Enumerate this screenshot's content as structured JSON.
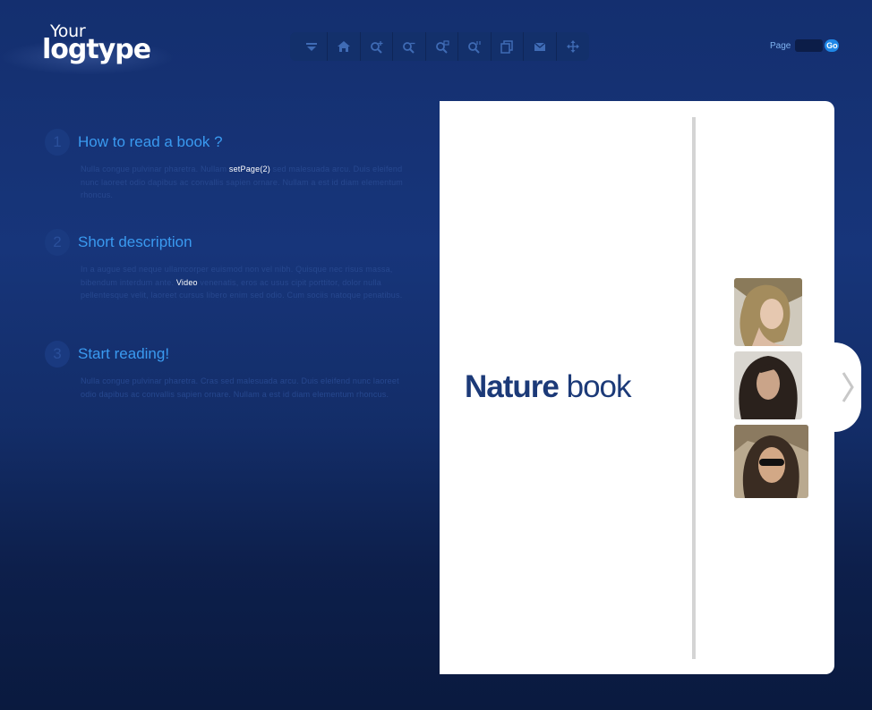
{
  "logo": {
    "line1": "Your",
    "line2": "logtype"
  },
  "toolbar": {
    "buttons": [
      {
        "name": "dropdown-arrow-icon"
      },
      {
        "name": "home-icon"
      },
      {
        "name": "zoom-in-icon"
      },
      {
        "name": "zoom-out-icon"
      },
      {
        "name": "zoom-fit-icon"
      },
      {
        "name": "zoom-actual-icon"
      },
      {
        "name": "pages-icon"
      },
      {
        "name": "email-icon"
      },
      {
        "name": "fullscreen-icon"
      }
    ]
  },
  "page_control": {
    "label": "Page",
    "value": "",
    "go_label": "Go"
  },
  "steps": [
    {
      "number": "1",
      "title": "How to read a book ?",
      "body_pre": "Nulla congue pulvinar pharetra. Nullam ",
      "body_link": "setPage(2)",
      "body_post": " sed malesuada arcu. Duis eleifend nunc laoreet odio dapibus ac convallis sapien ornare. Nullam a est id diam elementum rhoncus."
    },
    {
      "number": "2",
      "title": "Short description",
      "body_pre": "In a augue sed neque ullamcorper euismod non vel nibh. Quisque nec risus massa, bibendum interdum ante. ",
      "body_link": "Video",
      "body_post": " venenatis, eros ac usus cipit porttitor, dolor nulla pellentesque velit, laoreet cursus libero enim sed odio. Cum sociis natoque penatibus."
    },
    {
      "number": "3",
      "title": "Start reading!",
      "body_pre": "Nulla congue pulvinar pharetra. Cras sed malesuada arcu. Duis eleifend nunc laoreet odio dapibus ac convallis sapien ornare. Nullam a est id diam elementum rhoncus.",
      "body_link": "",
      "body_post": ""
    }
  ],
  "book": {
    "title_bold": "Nature",
    "title_light": " book"
  },
  "colors": {
    "accent": "#3a9af0",
    "book_title": "#1c3a78",
    "background": "#142f6f"
  }
}
